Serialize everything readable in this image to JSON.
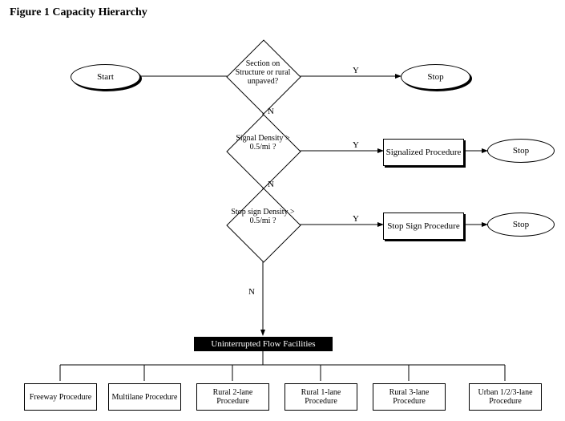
{
  "title": "Figure 1   Capacity Hierarchy",
  "start": "Start",
  "stop": "Stop",
  "d1": "Section on Structure or rural unpaved?",
  "d2": "Signal Density > 0.5/mi ?",
  "d3": "Stop sign Density > 0.5/mi ?",
  "p_sig": "Signalized Procedure",
  "p_stop": "Stop Sign Procedure",
  "uff": "Uninterrupted Flow Facilities",
  "yes": "Y",
  "no": "N",
  "procs": {
    "a": "Freeway Procedure",
    "b": "Multilane Procedure",
    "c": "Rural 2-lane Procedure",
    "d": "Rural 1-lane Procedure",
    "e": "Rural 3-lane Procedure",
    "f": "Urban 1/2/3-lane Procedure"
  }
}
